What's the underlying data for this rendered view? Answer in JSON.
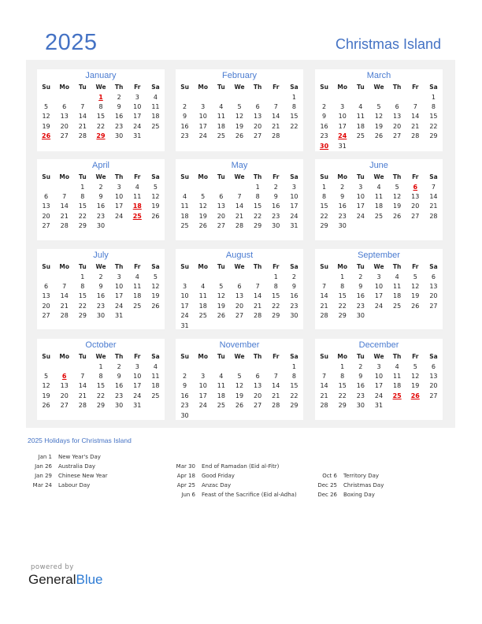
{
  "header": {
    "year": "2025",
    "country": "Christmas Island"
  },
  "weekdays": [
    "Su",
    "Mo",
    "Tu",
    "We",
    "Th",
    "Fr",
    "Sa"
  ],
  "colors": {
    "accent": "#4472c4",
    "holiday": "#e00000",
    "panel": "#f1f1f1"
  },
  "months": [
    {
      "name": "January",
      "offset": 3,
      "days": 31,
      "holidays": [
        1,
        26,
        29
      ]
    },
    {
      "name": "February",
      "offset": 6,
      "days": 28,
      "holidays": []
    },
    {
      "name": "March",
      "offset": 6,
      "days": 31,
      "holidays": [
        24,
        30
      ]
    },
    {
      "name": "April",
      "offset": 2,
      "days": 30,
      "holidays": [
        18,
        25
      ]
    },
    {
      "name": "May",
      "offset": 4,
      "days": 31,
      "holidays": []
    },
    {
      "name": "June",
      "offset": 0,
      "days": 30,
      "holidays": [
        6
      ]
    },
    {
      "name": "July",
      "offset": 2,
      "days": 31,
      "holidays": []
    },
    {
      "name": "August",
      "offset": 5,
      "days": 31,
      "holidays": []
    },
    {
      "name": "September",
      "offset": 1,
      "days": 30,
      "holidays": []
    },
    {
      "name": "October",
      "offset": 3,
      "days": 31,
      "holidays": [
        6
      ]
    },
    {
      "name": "November",
      "offset": 6,
      "days": 30,
      "holidays": []
    },
    {
      "name": "December",
      "offset": 1,
      "days": 31,
      "holidays": [
        25,
        26
      ]
    }
  ],
  "holidays_title": "2025 Holidays for Christmas Island",
  "holiday_columns": [
    [
      {
        "date": "Jan 1",
        "name": "New Year's Day"
      },
      {
        "date": "Jan 26",
        "name": "Australia Day"
      },
      {
        "date": "Jan 29",
        "name": "Chinese New Year"
      },
      {
        "date": "Mar 24",
        "name": "Labour Day"
      }
    ],
    [
      {
        "date": "Mar 30",
        "name": "End of Ramadan (Eid al-Fitr)"
      },
      {
        "date": "Apr 18",
        "name": "Good Friday"
      },
      {
        "date": "Apr 25",
        "name": "Anzac Day"
      },
      {
        "date": "Jun 6",
        "name": "Feast of the Sacrifice (Eid al-Adha)"
      }
    ],
    [
      {
        "date": "Oct 6",
        "name": "Territory Day"
      },
      {
        "date": "Dec 25",
        "name": "Christmas Day"
      },
      {
        "date": "Dec 26",
        "name": "Boxing Day"
      }
    ]
  ],
  "footer": {
    "powered_by": "powered by",
    "brand_general": "General",
    "brand_blue": "Blue"
  }
}
